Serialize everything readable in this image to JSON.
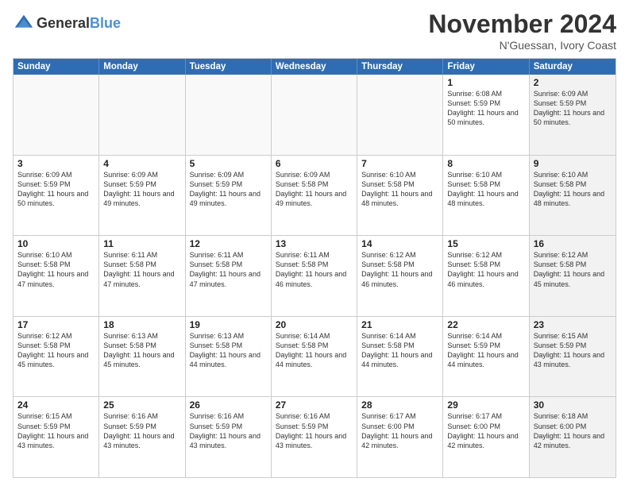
{
  "header": {
    "logo_general": "General",
    "logo_blue": "Blue",
    "month_title": "November 2024",
    "subtitle": "N'Guessan, Ivory Coast"
  },
  "days_of_week": [
    "Sunday",
    "Monday",
    "Tuesday",
    "Wednesday",
    "Thursday",
    "Friday",
    "Saturday"
  ],
  "weeks": [
    [
      {
        "day": "",
        "text": "",
        "shaded": false,
        "empty": true
      },
      {
        "day": "",
        "text": "",
        "shaded": false,
        "empty": true
      },
      {
        "day": "",
        "text": "",
        "shaded": false,
        "empty": true
      },
      {
        "day": "",
        "text": "",
        "shaded": false,
        "empty": true
      },
      {
        "day": "",
        "text": "",
        "shaded": false,
        "empty": true
      },
      {
        "day": "1",
        "text": "Sunrise: 6:08 AM\nSunset: 5:59 PM\nDaylight: 11 hours and 50 minutes.",
        "shaded": false,
        "empty": false
      },
      {
        "day": "2",
        "text": "Sunrise: 6:09 AM\nSunset: 5:59 PM\nDaylight: 11 hours and 50 minutes.",
        "shaded": true,
        "empty": false
      }
    ],
    [
      {
        "day": "3",
        "text": "Sunrise: 6:09 AM\nSunset: 5:59 PM\nDaylight: 11 hours and 50 minutes.",
        "shaded": false,
        "empty": false
      },
      {
        "day": "4",
        "text": "Sunrise: 6:09 AM\nSunset: 5:59 PM\nDaylight: 11 hours and 49 minutes.",
        "shaded": false,
        "empty": false
      },
      {
        "day": "5",
        "text": "Sunrise: 6:09 AM\nSunset: 5:59 PM\nDaylight: 11 hours and 49 minutes.",
        "shaded": false,
        "empty": false
      },
      {
        "day": "6",
        "text": "Sunrise: 6:09 AM\nSunset: 5:58 PM\nDaylight: 11 hours and 49 minutes.",
        "shaded": false,
        "empty": false
      },
      {
        "day": "7",
        "text": "Sunrise: 6:10 AM\nSunset: 5:58 PM\nDaylight: 11 hours and 48 minutes.",
        "shaded": false,
        "empty": false
      },
      {
        "day": "8",
        "text": "Sunrise: 6:10 AM\nSunset: 5:58 PM\nDaylight: 11 hours and 48 minutes.",
        "shaded": false,
        "empty": false
      },
      {
        "day": "9",
        "text": "Sunrise: 6:10 AM\nSunset: 5:58 PM\nDaylight: 11 hours and 48 minutes.",
        "shaded": true,
        "empty": false
      }
    ],
    [
      {
        "day": "10",
        "text": "Sunrise: 6:10 AM\nSunset: 5:58 PM\nDaylight: 11 hours and 47 minutes.",
        "shaded": false,
        "empty": false
      },
      {
        "day": "11",
        "text": "Sunrise: 6:11 AM\nSunset: 5:58 PM\nDaylight: 11 hours and 47 minutes.",
        "shaded": false,
        "empty": false
      },
      {
        "day": "12",
        "text": "Sunrise: 6:11 AM\nSunset: 5:58 PM\nDaylight: 11 hours and 47 minutes.",
        "shaded": false,
        "empty": false
      },
      {
        "day": "13",
        "text": "Sunrise: 6:11 AM\nSunset: 5:58 PM\nDaylight: 11 hours and 46 minutes.",
        "shaded": false,
        "empty": false
      },
      {
        "day": "14",
        "text": "Sunrise: 6:12 AM\nSunset: 5:58 PM\nDaylight: 11 hours and 46 minutes.",
        "shaded": false,
        "empty": false
      },
      {
        "day": "15",
        "text": "Sunrise: 6:12 AM\nSunset: 5:58 PM\nDaylight: 11 hours and 46 minutes.",
        "shaded": false,
        "empty": false
      },
      {
        "day": "16",
        "text": "Sunrise: 6:12 AM\nSunset: 5:58 PM\nDaylight: 11 hours and 45 minutes.",
        "shaded": true,
        "empty": false
      }
    ],
    [
      {
        "day": "17",
        "text": "Sunrise: 6:12 AM\nSunset: 5:58 PM\nDaylight: 11 hours and 45 minutes.",
        "shaded": false,
        "empty": false
      },
      {
        "day": "18",
        "text": "Sunrise: 6:13 AM\nSunset: 5:58 PM\nDaylight: 11 hours and 45 minutes.",
        "shaded": false,
        "empty": false
      },
      {
        "day": "19",
        "text": "Sunrise: 6:13 AM\nSunset: 5:58 PM\nDaylight: 11 hours and 44 minutes.",
        "shaded": false,
        "empty": false
      },
      {
        "day": "20",
        "text": "Sunrise: 6:14 AM\nSunset: 5:58 PM\nDaylight: 11 hours and 44 minutes.",
        "shaded": false,
        "empty": false
      },
      {
        "day": "21",
        "text": "Sunrise: 6:14 AM\nSunset: 5:58 PM\nDaylight: 11 hours and 44 minutes.",
        "shaded": false,
        "empty": false
      },
      {
        "day": "22",
        "text": "Sunrise: 6:14 AM\nSunset: 5:59 PM\nDaylight: 11 hours and 44 minutes.",
        "shaded": false,
        "empty": false
      },
      {
        "day": "23",
        "text": "Sunrise: 6:15 AM\nSunset: 5:59 PM\nDaylight: 11 hours and 43 minutes.",
        "shaded": true,
        "empty": false
      }
    ],
    [
      {
        "day": "24",
        "text": "Sunrise: 6:15 AM\nSunset: 5:59 PM\nDaylight: 11 hours and 43 minutes.",
        "shaded": false,
        "empty": false
      },
      {
        "day": "25",
        "text": "Sunrise: 6:16 AM\nSunset: 5:59 PM\nDaylight: 11 hours and 43 minutes.",
        "shaded": false,
        "empty": false
      },
      {
        "day": "26",
        "text": "Sunrise: 6:16 AM\nSunset: 5:59 PM\nDaylight: 11 hours and 43 minutes.",
        "shaded": false,
        "empty": false
      },
      {
        "day": "27",
        "text": "Sunrise: 6:16 AM\nSunset: 5:59 PM\nDaylight: 11 hours and 43 minutes.",
        "shaded": false,
        "empty": false
      },
      {
        "day": "28",
        "text": "Sunrise: 6:17 AM\nSunset: 6:00 PM\nDaylight: 11 hours and 42 minutes.",
        "shaded": false,
        "empty": false
      },
      {
        "day": "29",
        "text": "Sunrise: 6:17 AM\nSunset: 6:00 PM\nDaylight: 11 hours and 42 minutes.",
        "shaded": false,
        "empty": false
      },
      {
        "day": "30",
        "text": "Sunrise: 6:18 AM\nSunset: 6:00 PM\nDaylight: 11 hours and 42 minutes.",
        "shaded": true,
        "empty": false
      }
    ]
  ]
}
